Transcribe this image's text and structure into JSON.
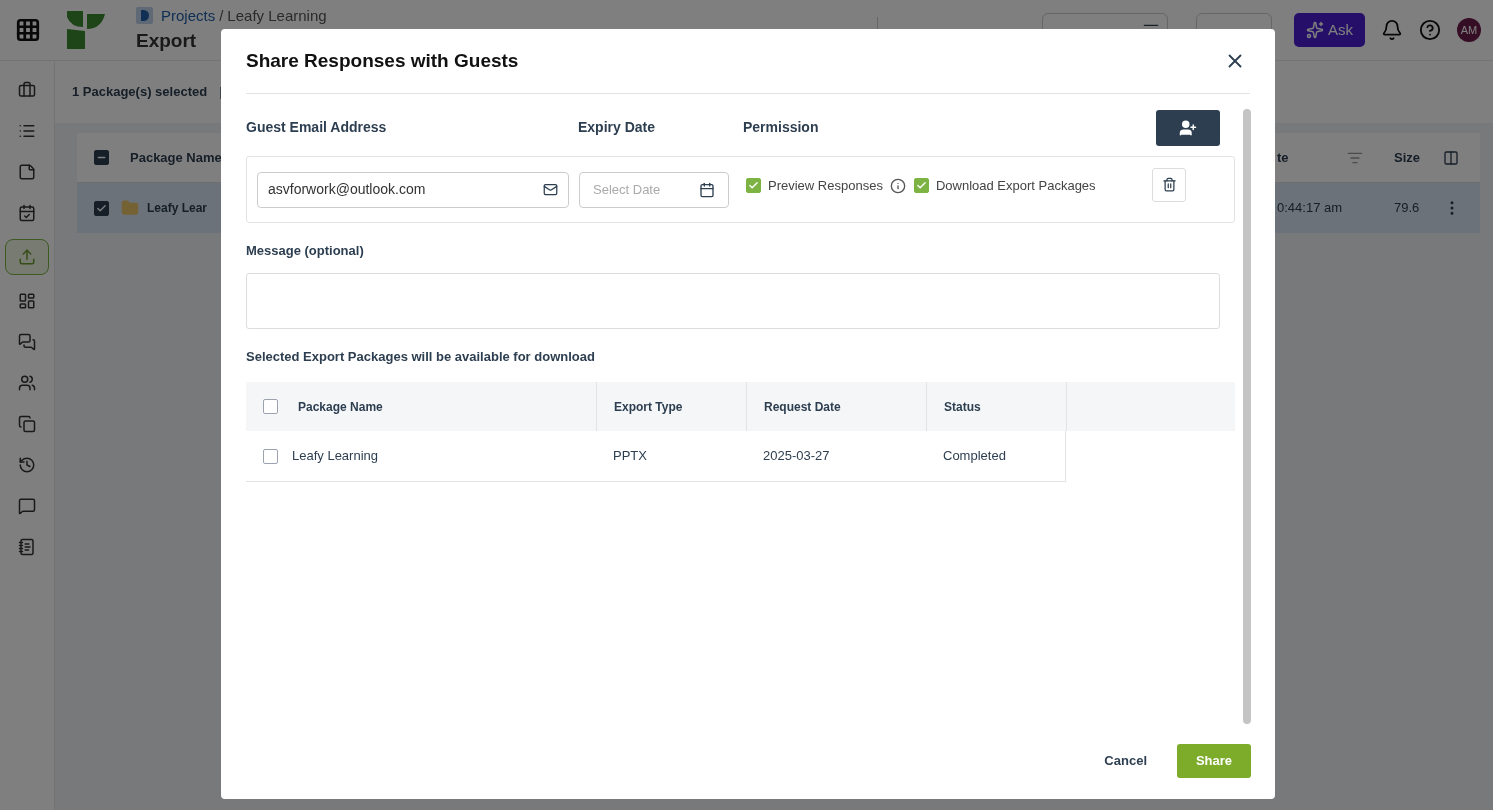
{
  "header": {
    "breadcrumb": {
      "root": "Projects",
      "separator": "/",
      "current": "Leafy Learning"
    },
    "title": "Export",
    "ask_button": "Ask",
    "avatar": "AM"
  },
  "sidebar": {
    "items": [
      {
        "selected": false
      },
      {
        "selected": false
      },
      {
        "selected": false
      },
      {
        "selected": false
      },
      {
        "selected": true
      },
      {
        "selected": false
      },
      {
        "selected": false
      },
      {
        "selected": false
      },
      {
        "selected": false
      },
      {
        "selected": false
      },
      {
        "selected": false
      },
      {
        "selected": false
      }
    ]
  },
  "background": {
    "selection": "1 Package(s) selected",
    "separator": "|",
    "columns": [
      "Package Name",
      "te",
      "Size"
    ],
    "row": {
      "checked": true,
      "name": "Leafy Lear",
      "time": "0:44:17 am",
      "size": "79.6"
    }
  },
  "dialog": {
    "title": "Share Responses with Guests",
    "columns": [
      "Guest Email Address",
      "Expiry Date",
      "Permission"
    ],
    "guests": [
      {
        "email": "asvforwork@outlook.com",
        "expiry": {
          "placeholder": "Select Date"
        },
        "permissions": [
          {
            "label": "Preview Responses",
            "checked": true,
            "info": true
          },
          {
            "label": "Download Export Packages",
            "checked": true,
            "info": false
          }
        ]
      }
    ],
    "message": {
      "label": "Message (optional)"
    },
    "packages_note": "Selected Export Packages will be available for download",
    "table": {
      "select_all": false,
      "columns": [
        "Package Name",
        "Export Type",
        "Request Date",
        "Status"
      ],
      "rows": [
        {
          "checked": false,
          "cells": [
            "Leafy Learning",
            "PPTX",
            "2025-03-27",
            "Completed"
          ]
        }
      ]
    },
    "buttons": {
      "cancel": "Cancel",
      "share": "Share"
    }
  }
}
